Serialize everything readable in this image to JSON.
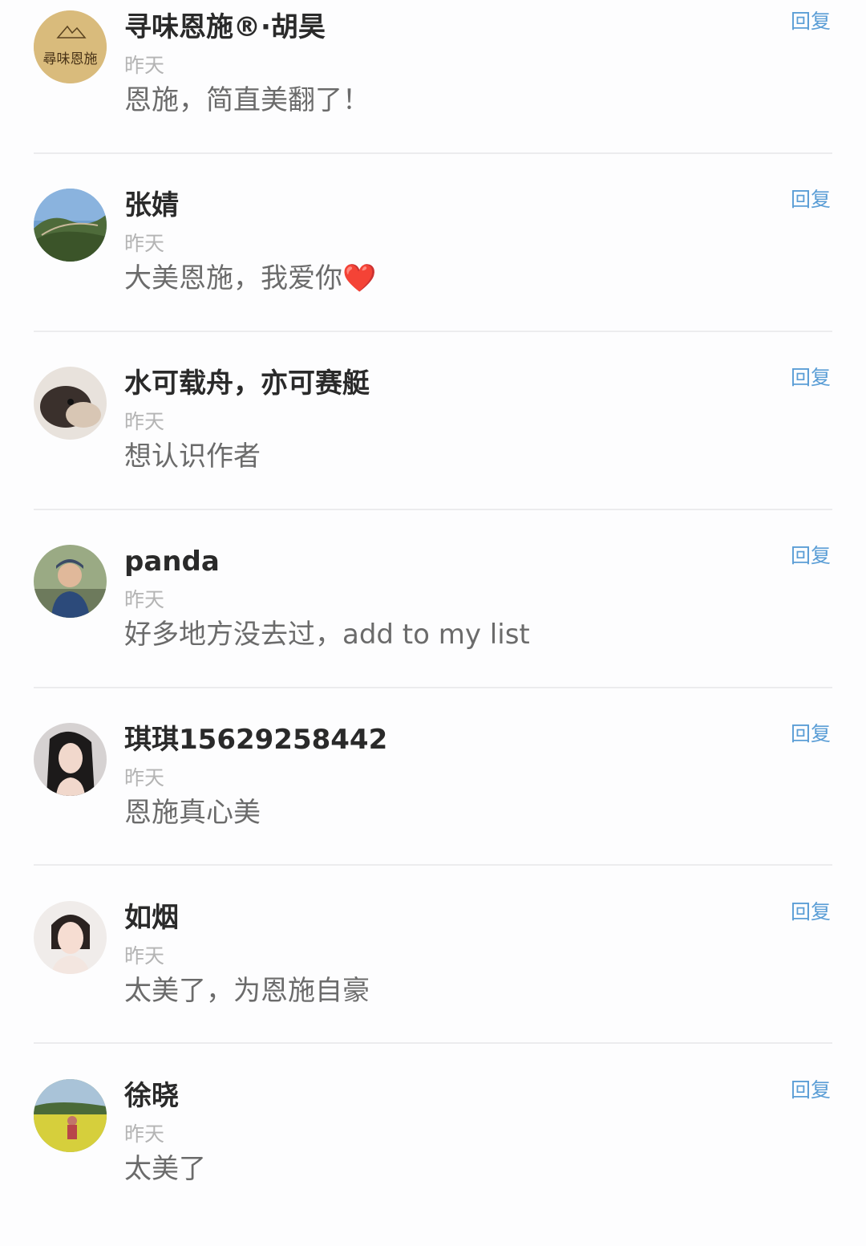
{
  "comments": [
    {
      "name": "寻味恩施®·胡昊",
      "time": "昨天",
      "text": "恩施，简直美翻了！",
      "reply_label": "回复",
      "avatar_text": "尋味恩施"
    },
    {
      "name": "张婧",
      "time": "昨天",
      "text": "大美恩施，我爱你❤️",
      "reply_label": "回复"
    },
    {
      "name": "水可载舟，亦可赛艇",
      "time": "昨天",
      "text": "想认识作者",
      "reply_label": "回复"
    },
    {
      "name": "panda",
      "time": "昨天",
      "text": "好多地方没去过，add to my list",
      "reply_label": "回复"
    },
    {
      "name": "琪琪15629258442",
      "time": "昨天",
      "text": "恩施真心美",
      "reply_label": "回复"
    },
    {
      "name": "如烟",
      "time": "昨天",
      "text": "太美了，为恩施自豪",
      "reply_label": "回复"
    },
    {
      "name": "徐晓",
      "time": "昨天",
      "text": "太美了",
      "reply_label": "回复"
    }
  ],
  "colors": {
    "reply": "#5b9ed6",
    "name": "#2a2a2a",
    "time": "#b4b4b4",
    "text": "#6b6b6b",
    "divider": "#ececee"
  }
}
